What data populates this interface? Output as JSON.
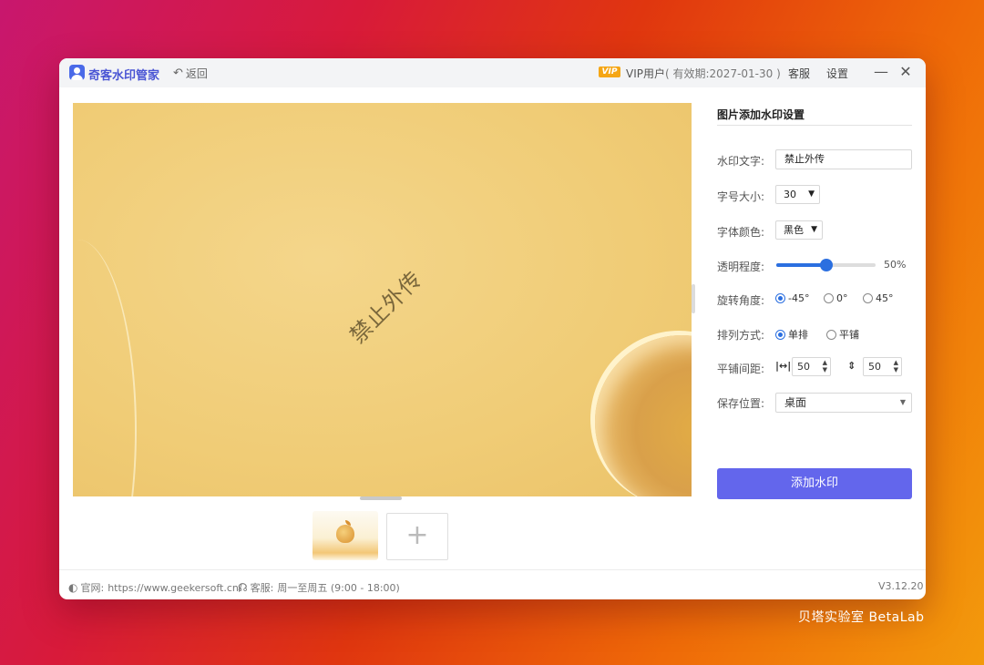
{
  "titlebar": {
    "app_name": "奇客水印管家",
    "back_label": "返回",
    "vip_badge": "VIP",
    "vip_user": "VIP用户",
    "vip_expiry": "( 有效期:2027-01-30 )",
    "support": "客服",
    "settings": "设置"
  },
  "preview": {
    "watermark_text": "禁止外传"
  },
  "settings": {
    "title": "图片添加水印设置",
    "watermark_text_label": "水印文字:",
    "watermark_text_value": "禁止外传",
    "font_size_label": "字号大小:",
    "font_size_value": "30",
    "font_color_label": "字体颜色:",
    "font_color_value": "黑色",
    "opacity_label": "透明程度:",
    "opacity_value": "50%",
    "opacity_fraction": 0.5,
    "rotation_label": "旋转角度:",
    "rotation_options": [
      "-45°",
      "0°",
      "45°"
    ],
    "rotation_selected": "-45°",
    "layout_label": "排列方式:",
    "layout_options": [
      "单排",
      "平铺"
    ],
    "layout_selected": "单排",
    "spacing_label": "平铺间距:",
    "spacing_h": "50",
    "spacing_v": "50",
    "save_label": "保存位置:",
    "save_value": "桌面",
    "add_button": "添加水印"
  },
  "statusbar": {
    "website_label": "官网:",
    "website_url": "https://www.geekersoft.cn/",
    "support_label": "客服:",
    "support_hours": "周一至周五 (9:00 - 18:00)",
    "version": "V3.12.20"
  },
  "brand": "贝塔实验室 BetaLab",
  "colors": {
    "accent": "#6366ec",
    "control_blue": "#2b6fe0",
    "vip_gold": "#f5a615"
  }
}
